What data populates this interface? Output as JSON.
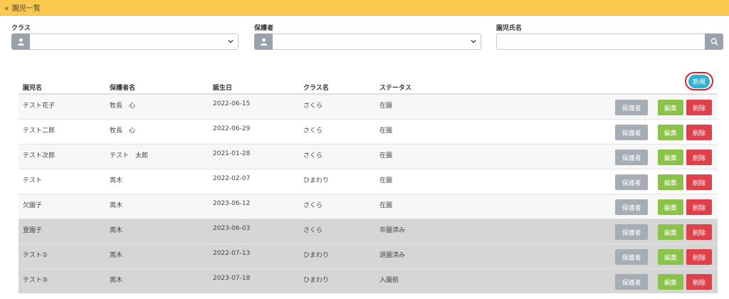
{
  "topbar": {
    "back_label": "園児一覧"
  },
  "filters": {
    "class_label": "クラス",
    "guardian_label": "保護者",
    "child_name_label": "園児氏名",
    "child_name_value": "",
    "class_value": "",
    "guardian_value": ""
  },
  "new_button_label": "新規",
  "table": {
    "headers": [
      "園児名",
      "保護者名",
      "誕生日",
      "クラス名",
      "ステータス"
    ],
    "rows": [
      [
        "テスト花子",
        "牧長　心",
        "2022-06-15",
        "さくら",
        "在園"
      ],
      [
        "テスト二郎",
        "牧長　心",
        "2022-06-29",
        "さくら",
        "在園"
      ],
      [
        "テスト次郎",
        "テスト　太郎",
        "2021-01-28",
        "さくら",
        "在園"
      ],
      [
        "テスト",
        "嵩木",
        "2022-02-07",
        "ひまわり",
        "在園"
      ],
      [
        "欠園子",
        "嵩木",
        "2023-06-12",
        "さくら",
        "在園"
      ],
      [
        "登園子",
        "嵩木",
        "2023-06-03",
        "さくら",
        "卒園済み"
      ],
      [
        "テスト②",
        "嵩木",
        "2022-07-13",
        "ひまわり",
        "退園済み"
      ],
      [
        "テスト③",
        "嵩木",
        "2023-07-18",
        "ひまわり",
        "入園前"
      ]
    ],
    "row_actions": {
      "guardian": "保護者",
      "edit": "編集",
      "delete": "削除"
    }
  },
  "colors": {
    "topbar": "#fcc94f",
    "new_button": "#31b0d5",
    "edit": "#8bc34a",
    "delete": "#e0404a",
    "guardian": "#a6adb4"
  },
  "icons": [
    "double-chevron-left-icon",
    "user-icon",
    "chevron-down-icon",
    "search-icon"
  ]
}
